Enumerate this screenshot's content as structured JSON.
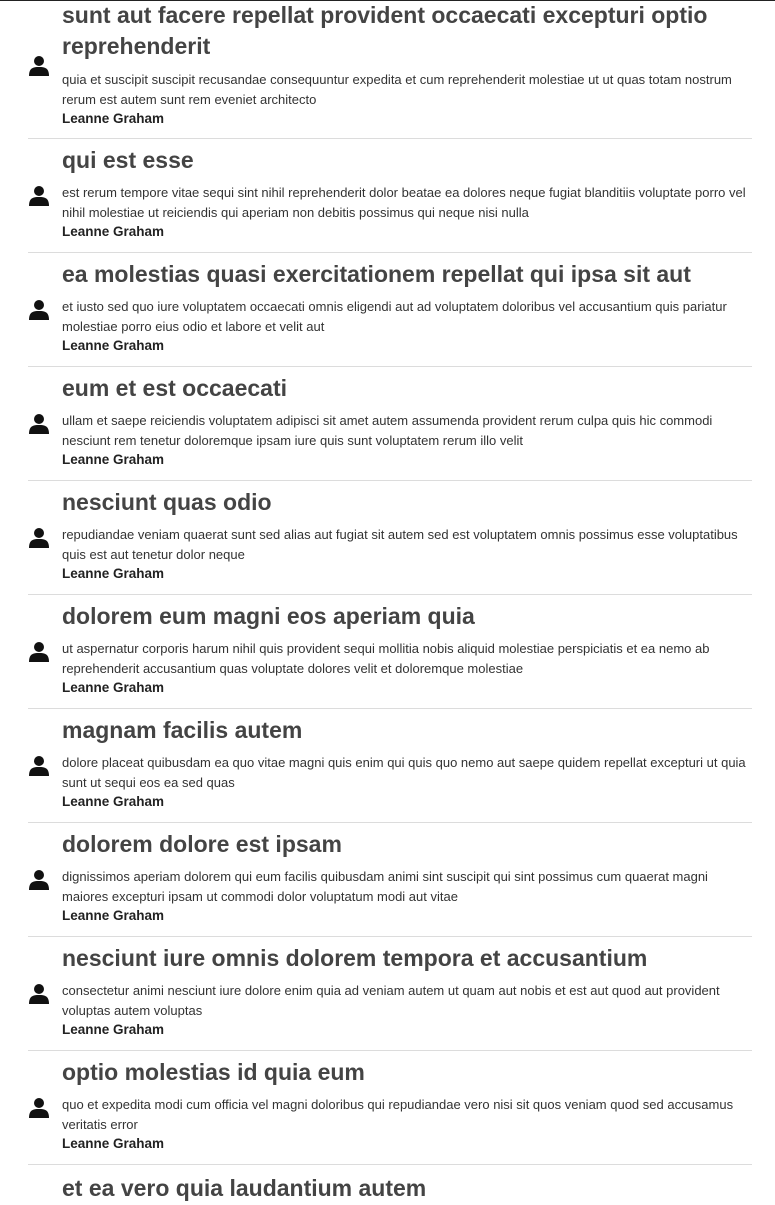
{
  "posts": [
    {
      "title": "sunt aut facere repellat provident occaecati excepturi optio reprehenderit",
      "body": "quia et suscipit suscipit recusandae consequuntur expedita et cum reprehenderit molestiae ut ut quas totam nostrum rerum est autem sunt rem eveniet architecto",
      "author": "Leanne Graham"
    },
    {
      "title": "qui est esse",
      "body": "est rerum tempore vitae sequi sint nihil reprehenderit dolor beatae ea dolores neque fugiat blanditiis voluptate porro vel nihil molestiae ut reiciendis qui aperiam non debitis possimus qui neque nisi nulla",
      "author": "Leanne Graham"
    },
    {
      "title": "ea molestias quasi exercitationem repellat qui ipsa sit aut",
      "body": "et iusto sed quo iure voluptatem occaecati omnis eligendi aut ad voluptatem doloribus vel accusantium quis pariatur molestiae porro eius odio et labore et velit aut",
      "author": "Leanne Graham"
    },
    {
      "title": "eum et est occaecati",
      "body": "ullam et saepe reiciendis voluptatem adipisci sit amet autem assumenda provident rerum culpa quis hic commodi nesciunt rem tenetur doloremque ipsam iure quis sunt voluptatem rerum illo velit",
      "author": "Leanne Graham"
    },
    {
      "title": "nesciunt quas odio",
      "body": "repudiandae veniam quaerat sunt sed alias aut fugiat sit autem sed est voluptatem omnis possimus esse voluptatibus quis est aut tenetur dolor neque",
      "author": "Leanne Graham"
    },
    {
      "title": "dolorem eum magni eos aperiam quia",
      "body": "ut aspernatur corporis harum nihil quis provident sequi mollitia nobis aliquid molestiae perspiciatis et ea nemo ab reprehenderit accusantium quas voluptate dolores velit et doloremque molestiae",
      "author": "Leanne Graham"
    },
    {
      "title": "magnam facilis autem",
      "body": "dolore placeat quibusdam ea quo vitae magni quis enim qui quis quo nemo aut saepe quidem repellat excepturi ut quia sunt ut sequi eos ea sed quas",
      "author": "Leanne Graham"
    },
    {
      "title": "dolorem dolore est ipsam",
      "body": "dignissimos aperiam dolorem qui eum facilis quibusdam animi sint suscipit qui sint possimus cum quaerat magni maiores excepturi ipsam ut commodi dolor voluptatum modi aut vitae",
      "author": "Leanne Graham"
    },
    {
      "title": "nesciunt iure omnis dolorem tempora et accusantium",
      "body": "consectetur animi nesciunt iure dolore enim quia ad veniam autem ut quam aut nobis et est aut quod aut provident voluptas autem voluptas",
      "author": "Leanne Graham"
    },
    {
      "title": "optio molestias id quia eum",
      "body": "quo et expedita modi cum officia vel magni doloribus qui repudiandae vero nisi sit quos veniam quod sed accusamus veritatis error",
      "author": "Leanne Graham"
    },
    {
      "title": "et ea vero quia laudantium autem",
      "body": "",
      "author": ""
    }
  ],
  "icons": {
    "avatar": "user-icon"
  },
  "colors": {
    "title": "#444444",
    "text": "#333333",
    "divider": "#dcdcdc"
  }
}
